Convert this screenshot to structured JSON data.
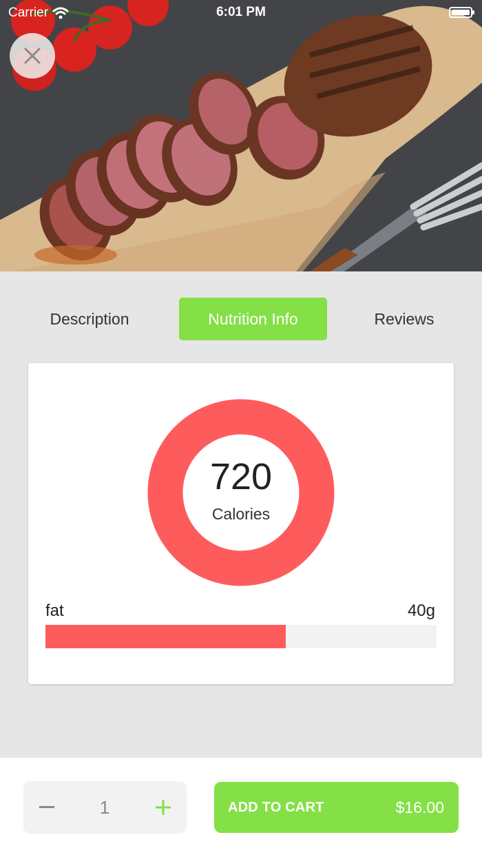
{
  "status_bar": {
    "carrier": "Carrier",
    "time": "6:01 PM"
  },
  "hero": {
    "image": "sliced-steak-on-cutting-board",
    "close_icon": "close-icon"
  },
  "tabs": [
    {
      "label": "Description",
      "active": false
    },
    {
      "label": "Nutrition Info",
      "active": true
    },
    {
      "label": "Reviews",
      "active": false
    }
  ],
  "nutrition": {
    "calories_value": "720",
    "calories_label": "Calories",
    "nutrients": [
      {
        "name": "fat",
        "value": "40g",
        "fraction": 0.615
      }
    ]
  },
  "cart": {
    "quantity": "1",
    "minus_icon": "minus-icon",
    "plus_icon": "plus-icon",
    "add_label": "ADD TO CART",
    "price": "$16.00"
  },
  "colors": {
    "accent_green": "#84e046",
    "calorie_red": "#fe5c5c"
  }
}
